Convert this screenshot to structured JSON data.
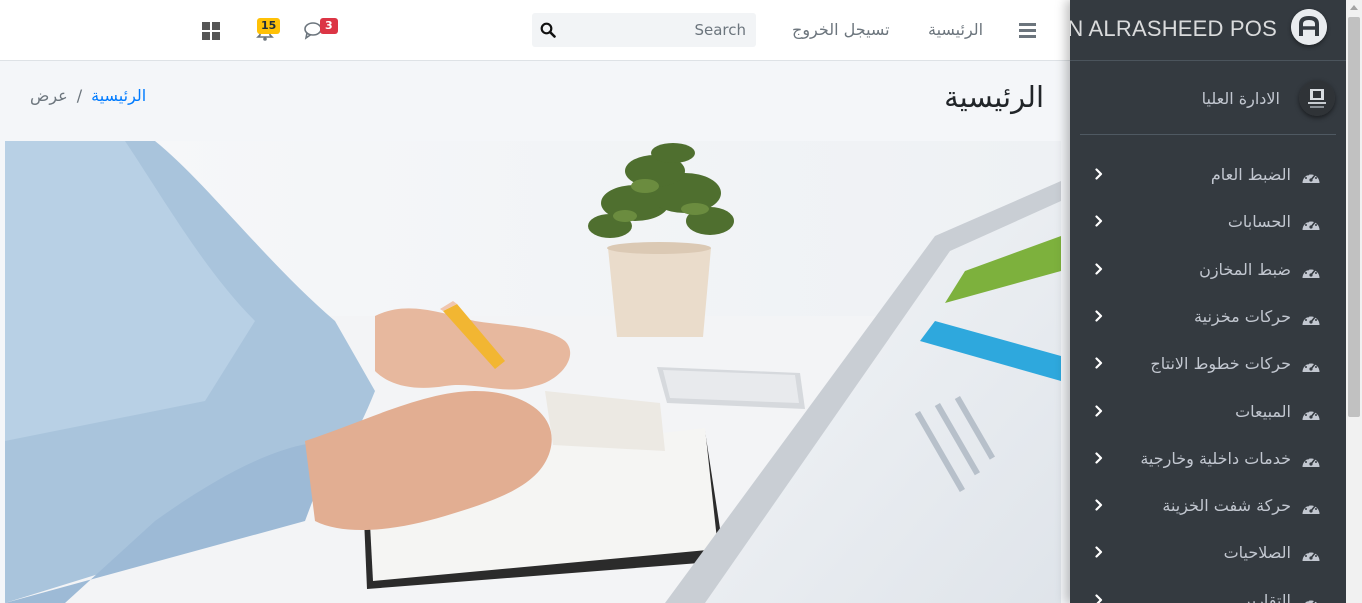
{
  "navbar": {
    "apps_icon": "grid-icon",
    "notifications": {
      "icon": "bell-icon",
      "count": "15",
      "color": "#ffc107"
    },
    "messages": {
      "icon": "comments-icon",
      "count": "3",
      "color": "#dc3545"
    },
    "search": {
      "placeholder": "Search",
      "icon": "search-icon"
    },
    "logout_label": "تسيجل الخروج",
    "home_label": "الرئيسية",
    "menu_icon": "bars-icon"
  },
  "content_header": {
    "title": "الرئيسية",
    "breadcrumb": {
      "home": "الرئيسية",
      "separator": "/",
      "current": "عرض"
    }
  },
  "sidebar": {
    "brand": "DON ALRASHEED POS",
    "user": {
      "name": "الادارة العليا"
    },
    "menu": [
      {
        "label": "الضبط العام",
        "icon": "tachometer-icon"
      },
      {
        "label": "الحسابات",
        "icon": "tachometer-icon"
      },
      {
        "label": "ضبط المخازن",
        "icon": "tachometer-icon"
      },
      {
        "label": "حركات مخزنية",
        "icon": "tachometer-icon"
      },
      {
        "label": "حركات خطوط الانتاج",
        "icon": "tachometer-icon"
      },
      {
        "label": "المبيعات",
        "icon": "tachometer-icon"
      },
      {
        "label": "خدمات داخلية وخارجية",
        "icon": "tachometer-icon"
      },
      {
        "label": "حركة شفت الخزينة",
        "icon": "tachometer-icon"
      },
      {
        "label": "الصلاحيات",
        "icon": "tachometer-icon"
      },
      {
        "label": "التقارير",
        "icon": "tachometer-icon"
      }
    ]
  },
  "colors": {
    "sidebar_bg": "#343a40",
    "link": "#007bff",
    "badge_warning": "#ffc107",
    "badge_danger": "#dc3545"
  }
}
